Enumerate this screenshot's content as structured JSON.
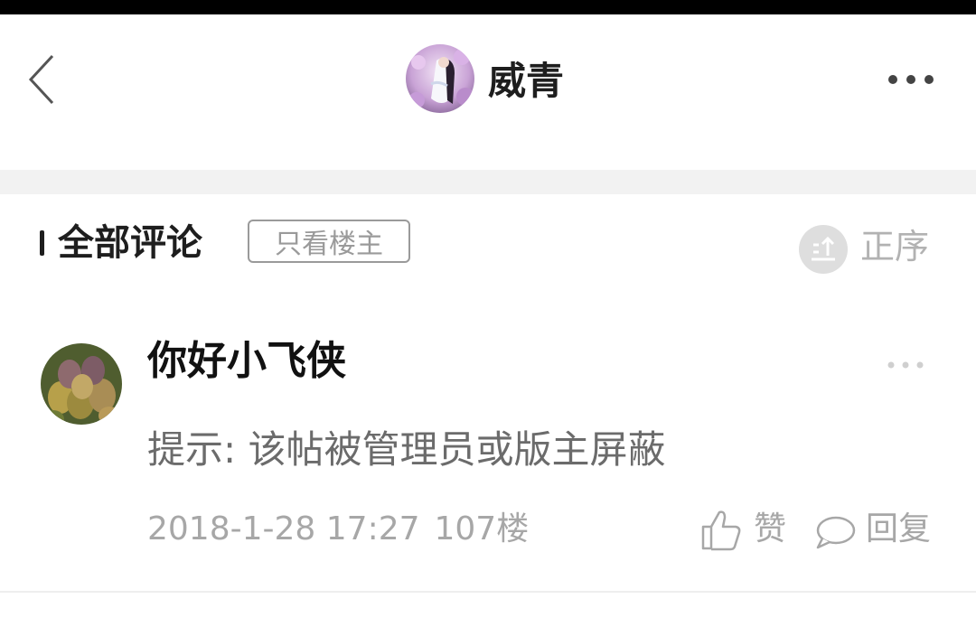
{
  "header": {
    "title": "威青",
    "back_icon": "chevron-left-icon",
    "more_icon": "more-horizontal-icon"
  },
  "comments_header": {
    "title": "全部评论",
    "only_host_label": "只看楼主",
    "sort_label": "正序",
    "sort_icon": "sort-ascending-icon"
  },
  "comment": {
    "username": "你好小飞侠",
    "text": "提示: 该帖被管理员或版主屏蔽",
    "date": "2018-1-28 17:27",
    "floor": "107楼",
    "like_label": "赞",
    "reply_label": "回复",
    "like_icon": "thumbs-up-icon",
    "reply_icon": "speech-bubble-icon"
  },
  "colors": {
    "background": "#ffffff",
    "divider": "#f2f2f2",
    "muted_text": "#a7a7a7",
    "title_text": "#1e1e1e"
  }
}
